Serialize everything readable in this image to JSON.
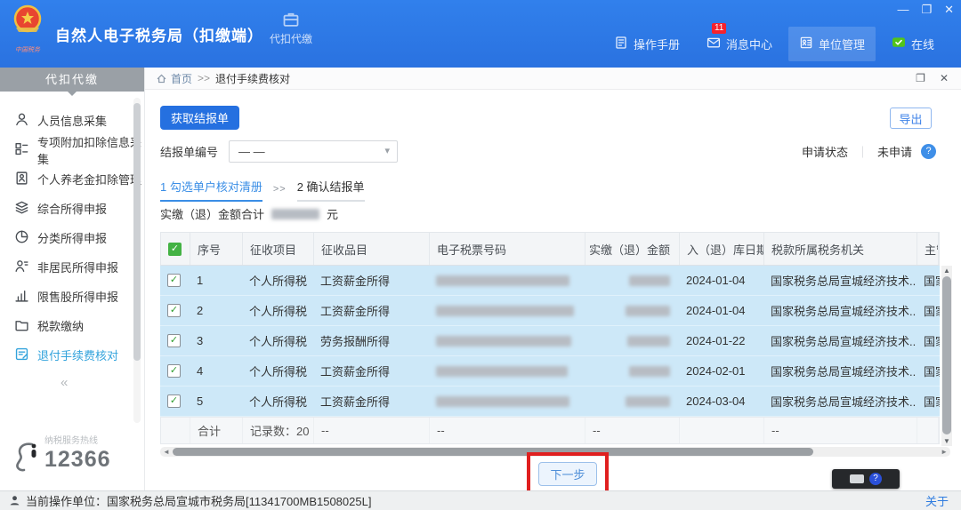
{
  "colors": {
    "header_blue": "#2b76e4",
    "active_item": "#33a3dc",
    "row_selected": "#cde8f8",
    "badge_red": "#f5222d",
    "online_green": "#52c41a",
    "annotation_red": "#e01f1f"
  },
  "header": {
    "title": "自然人电子税务局（扣缴端）",
    "brand_caption": "中国税务",
    "top_tab": {
      "label": "代扣代缴",
      "icon": "briefcase-icon"
    },
    "menu": [
      {
        "label": "操作手册",
        "icon": "manual-icon"
      },
      {
        "label": "消息中心",
        "icon": "message-icon",
        "badge": "11"
      },
      {
        "label": "单位管理",
        "icon": "org-icon",
        "highlighted": true
      },
      {
        "label": "在线",
        "icon": "online-icon"
      }
    ],
    "window_controls": {
      "minimize": "—",
      "restore": "❐",
      "close": "✕"
    }
  },
  "sidebar": {
    "header": "代扣代缴",
    "items": [
      {
        "label": "人员信息采集",
        "icon": "person-icon",
        "active": false
      },
      {
        "label": "专项附加扣除信息采集",
        "icon": "grid-icon",
        "active": false
      },
      {
        "label": "个人养老金扣除管理",
        "icon": "pension-doc-icon",
        "active": false
      },
      {
        "label": "综合所得申报",
        "icon": "layers-icon",
        "active": false
      },
      {
        "label": "分类所得申报",
        "icon": "pie-icon",
        "active": false
      },
      {
        "label": "非居民所得申报",
        "icon": "nonresident-icon",
        "active": false
      },
      {
        "label": "限售股所得申报",
        "icon": "bar-chart-icon",
        "active": false
      },
      {
        "label": "税款缴纳",
        "icon": "folder-icon",
        "active": false
      },
      {
        "label": "退付手续费核对",
        "icon": "doc-check-icon",
        "active": true
      }
    ],
    "collapse_glyph": "«",
    "hotline": {
      "label": "纳税服务热线",
      "number": "12366"
    }
  },
  "breadcrumb": {
    "home": "首页",
    "separator": ">>",
    "current": "退付手续费核对"
  },
  "toolbar": {
    "fetch_button": "获取结报单",
    "export_button": "导出",
    "form_label": "结报单编号",
    "form_value": "— —",
    "status_label": "申请状态",
    "status_value": "未申请"
  },
  "steps": {
    "step1": "1 勾选单户核对清册",
    "separator": ">>",
    "step2": "2 确认结报单"
  },
  "summary": {
    "label": "实缴（退）金额合计",
    "unit": "元"
  },
  "table": {
    "headers": [
      "序号",
      "征收项目",
      "征收品目",
      "电子税票号码",
      "实缴（退）金额",
      "入（退）库日期",
      "税款所属税务机关",
      "主管"
    ],
    "rows": [
      {
        "seq": "1",
        "item": "个人所得税",
        "category": "工资薪金所得",
        "date": "2024-01-04",
        "organ": "国家税务总局宣城经济技术...",
        "supervisor": "国家"
      },
      {
        "seq": "2",
        "item": "个人所得税",
        "category": "工资薪金所得",
        "date": "2024-01-04",
        "organ": "国家税务总局宣城经济技术...",
        "supervisor": "国家"
      },
      {
        "seq": "3",
        "item": "个人所得税",
        "category": "劳务报酬所得",
        "date": "2024-01-22",
        "organ": "国家税务总局宣城经济技术...",
        "supervisor": "国家"
      },
      {
        "seq": "4",
        "item": "个人所得税",
        "category": "工资薪金所得",
        "date": "2024-02-01",
        "organ": "国家税务总局宣城经济技术...",
        "supervisor": "国家"
      },
      {
        "seq": "5",
        "item": "个人所得税",
        "category": "工资薪金所得",
        "date": "2024-03-04",
        "organ": "国家税务总局宣城经济技术...",
        "supervisor": "国家"
      }
    ],
    "footer": {
      "total_label": "合计",
      "record_count": "记录数：20",
      "dash": "--"
    }
  },
  "actions": {
    "next_button": "下一步"
  },
  "statusbar": {
    "text": "当前操作单位：国家税务总局宣城市税务局[11341700MB1508025L]",
    "about": "关于"
  }
}
